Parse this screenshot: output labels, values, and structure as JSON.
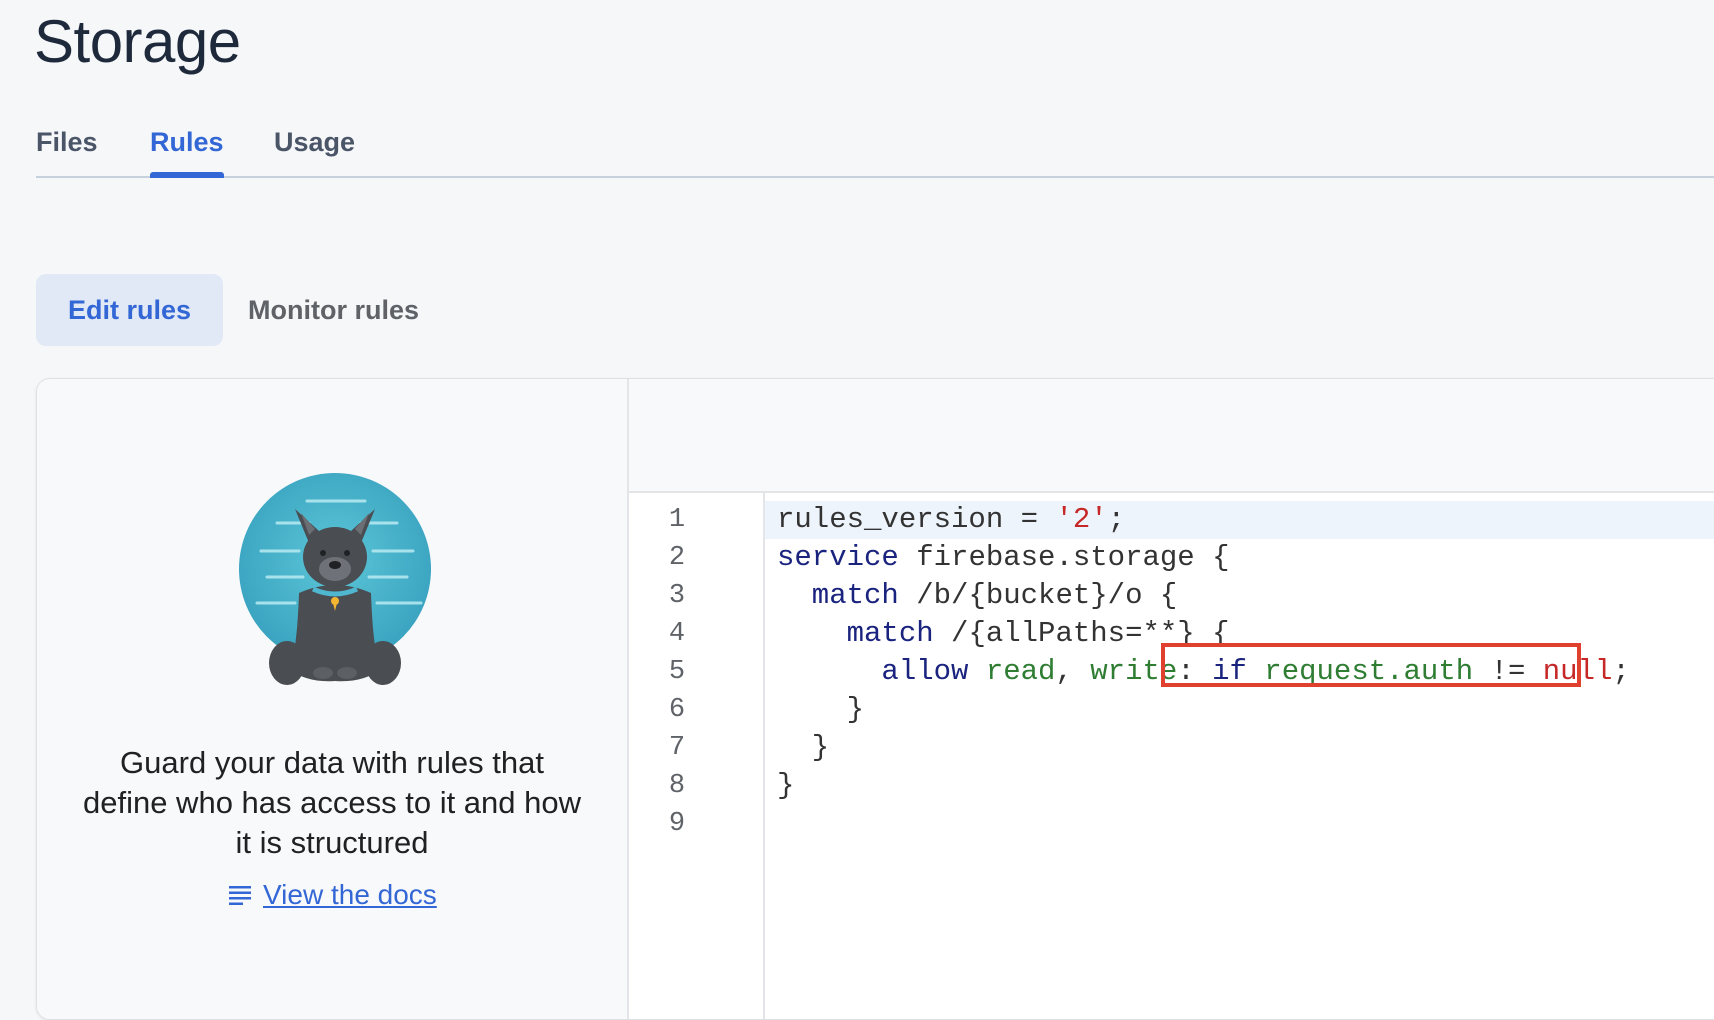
{
  "page": {
    "title": "Storage"
  },
  "tabs": [
    {
      "label": "Files",
      "active": false
    },
    {
      "label": "Rules",
      "active": true
    },
    {
      "label": "Usage",
      "active": false
    }
  ],
  "subtabs": [
    {
      "label": "Edit rules",
      "active": true
    },
    {
      "label": "Monitor rules",
      "active": false
    }
  ],
  "left_panel": {
    "illustration_icon": "dog-mascot-icon",
    "description": "Guard your data with rules that define who has access to it and how it is structured",
    "docs_icon": "document-lines-icon",
    "docs_label": "View the docs"
  },
  "editor": {
    "line_numbers": [
      "1",
      "2",
      "3",
      "4",
      "5",
      "6",
      "7",
      "8",
      "9"
    ],
    "lines": [
      [
        {
          "t": "rules_version = ",
          "c": "pl"
        },
        {
          "t": "'2'",
          "c": "red"
        },
        {
          "t": ";",
          "c": "pl"
        }
      ],
      [
        {
          "t": "service",
          "c": "kw"
        },
        {
          "t": " firebase.storage {",
          "c": "pl"
        }
      ],
      [
        {
          "t": "  match",
          "c": "kw"
        },
        {
          "t": " /b/{bucket}/o {",
          "c": "pl"
        }
      ],
      [
        {
          "t": "    match",
          "c": "kw"
        },
        {
          "t": " /{allPaths=**} {",
          "c": "pl"
        }
      ],
      [
        {
          "t": "      allow",
          "c": "kw"
        },
        {
          "t": " read",
          "c": "grn"
        },
        {
          "t": ", ",
          "c": "pl"
        },
        {
          "t": "write",
          "c": "grn"
        },
        {
          "t": ": ",
          "c": "pl"
        },
        {
          "t": "if",
          "c": "kw"
        },
        {
          "t": " request.auth",
          "c": "grn"
        },
        {
          "t": " != ",
          "c": "pl"
        },
        {
          "t": "null",
          "c": "red"
        },
        {
          "t": ";",
          "c": "pl"
        }
      ],
      [
        {
          "t": "    }",
          "c": "pl"
        }
      ],
      [
        {
          "t": "  }",
          "c": "pl"
        }
      ],
      [
        {
          "t": "}",
          "c": "pl"
        }
      ],
      []
    ]
  },
  "colors": {
    "accent": "#3367d6",
    "highlight_box": "#e0412f"
  }
}
